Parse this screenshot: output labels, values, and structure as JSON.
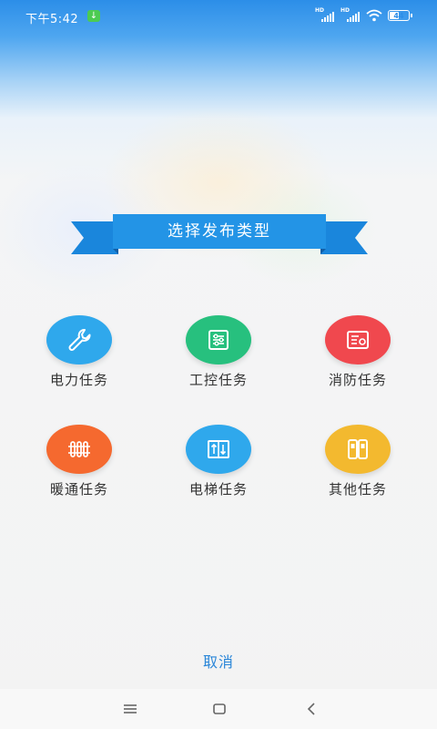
{
  "status_bar": {
    "time": "下午5:42",
    "download_icon": "download-icon",
    "signal_1_label": "HD",
    "signal_2_label": "HD",
    "battery_level": "44"
  },
  "dialog": {
    "title": "选择发布类型",
    "categories": [
      {
        "label": "电力任务",
        "icon": "wrench-icon",
        "color": "#2fa8ec"
      },
      {
        "label": "工控任务",
        "icon": "control-panel-icon",
        "color": "#27c07e"
      },
      {
        "label": "消防任务",
        "icon": "fire-panel-icon",
        "color": "#f0484e"
      },
      {
        "label": "暖通任务",
        "icon": "radiator-icon",
        "color": "#f5692f"
      },
      {
        "label": "电梯任务",
        "icon": "elevator-icon",
        "color": "#2fa8ec"
      },
      {
        "label": "其他任务",
        "icon": "other-devices-icon",
        "color": "#f3b92f"
      }
    ],
    "cancel_label": "取消"
  },
  "colors": {
    "banner": "#1f8de0",
    "banner_dark": "#1672c4",
    "accent_text": "#2a86d8"
  }
}
